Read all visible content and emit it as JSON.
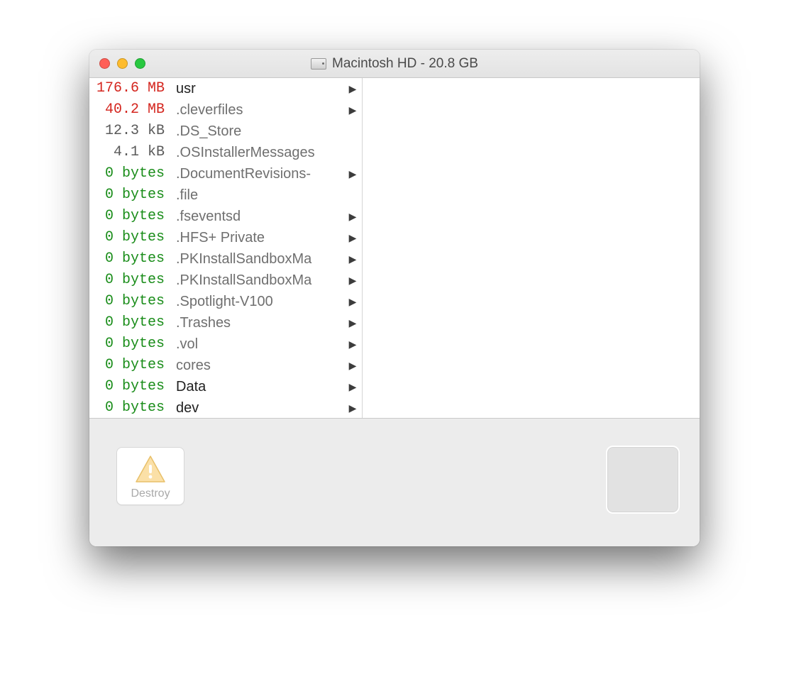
{
  "window": {
    "title": "Macintosh HD - 20.8 GB"
  },
  "colors": {
    "red": "#d4261f",
    "green": "#1a8d1a",
    "gray": "#5a5a5a"
  },
  "items": [
    {
      "size": "176.6 MB",
      "color": "red",
      "name": "usr",
      "dim": false,
      "folder": true
    },
    {
      "size": "40.2 MB",
      "color": "red",
      "name": ".cleverfiles",
      "dim": true,
      "folder": true
    },
    {
      "size": "12.3 kB",
      "color": "gray",
      "name": ".DS_Store",
      "dim": true,
      "folder": false
    },
    {
      "size": "4.1 kB",
      "color": "gray",
      "name": ".OSInstallerMessages",
      "dim": true,
      "folder": false
    },
    {
      "size": "0 bytes",
      "color": "green",
      "name": ".DocumentRevisions-",
      "dim": true,
      "folder": true
    },
    {
      "size": "0 bytes",
      "color": "green",
      "name": ".file",
      "dim": true,
      "folder": false
    },
    {
      "size": "0 bytes",
      "color": "green",
      "name": ".fseventsd",
      "dim": true,
      "folder": true
    },
    {
      "size": "0 bytes",
      "color": "green",
      "name": ".HFS+ Private",
      "dim": true,
      "folder": true
    },
    {
      "size": "0 bytes",
      "color": "green",
      "name": ".PKInstallSandboxMa",
      "dim": true,
      "folder": true
    },
    {
      "size": "0 bytes",
      "color": "green",
      "name": ".PKInstallSandboxMa",
      "dim": true,
      "folder": true
    },
    {
      "size": "0 bytes",
      "color": "green",
      "name": ".Spotlight-V100",
      "dim": true,
      "folder": true
    },
    {
      "size": "0 bytes",
      "color": "green",
      "name": ".Trashes",
      "dim": true,
      "folder": true
    },
    {
      "size": "0 bytes",
      "color": "green",
      "name": ".vol",
      "dim": true,
      "folder": true
    },
    {
      "size": "0 bytes",
      "color": "green",
      "name": "cores",
      "dim": true,
      "folder": true
    },
    {
      "size": "0 bytes",
      "color": "green",
      "name": "Data",
      "dim": false,
      "folder": true
    },
    {
      "size": "0 bytes",
      "color": "green",
      "name": "dev",
      "dim": false,
      "folder": true
    }
  ],
  "footer": {
    "destroy_label": "Destroy"
  }
}
